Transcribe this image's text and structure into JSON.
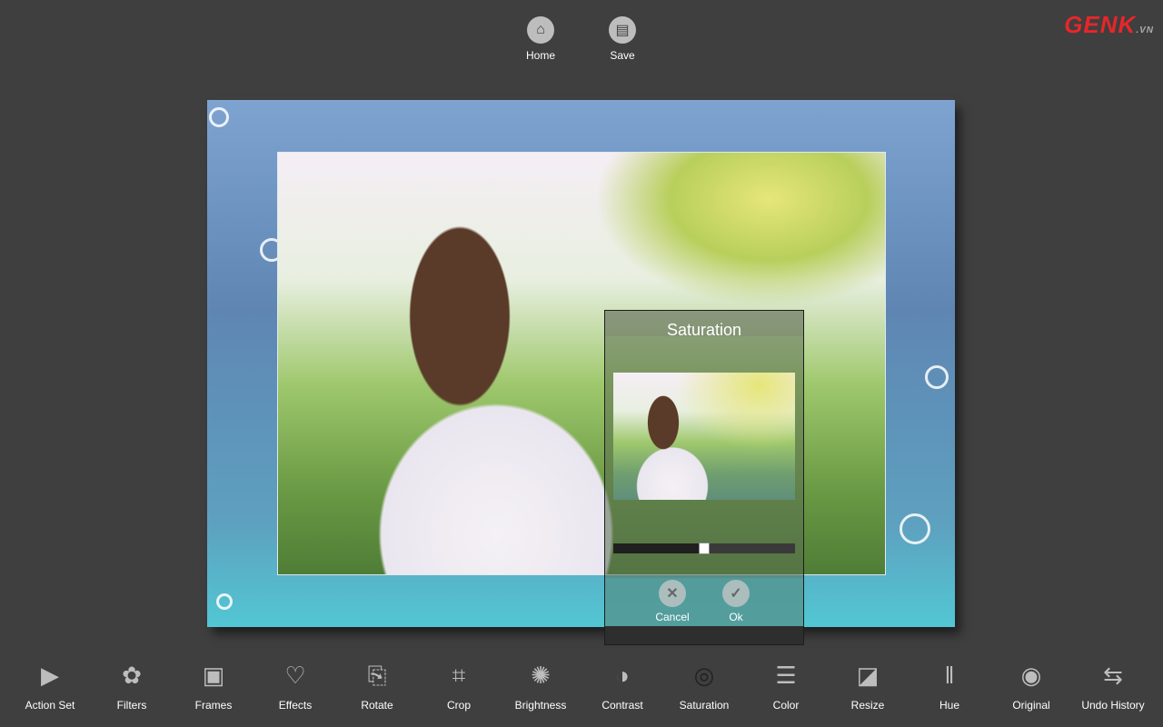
{
  "top": {
    "home": "Home",
    "save": "Save"
  },
  "logo": {
    "text": "GENK",
    "suffix": ".VN"
  },
  "dialog": {
    "title": "Saturation",
    "slider_value": 0.5,
    "cancel": "Cancel",
    "ok": "Ok"
  },
  "toolbar": [
    {
      "label": "Action Set",
      "icon": "play-icon",
      "glyph": "▶"
    },
    {
      "label": "Filters",
      "icon": "flower-icon",
      "glyph": "✿"
    },
    {
      "label": "Frames",
      "icon": "frame-star-icon",
      "glyph": "▣"
    },
    {
      "label": "Effects",
      "icon": "heart-icon",
      "glyph": "♡"
    },
    {
      "label": "Rotate",
      "icon": "rotate-icon",
      "glyph": "⎘"
    },
    {
      "label": "Crop",
      "icon": "crop-icon",
      "glyph": "⌗"
    },
    {
      "label": "Brightness",
      "icon": "sun-icon",
      "glyph": "✺"
    },
    {
      "label": "Contrast",
      "icon": "contrast-icon",
      "glyph": "◑"
    },
    {
      "label": "Saturation",
      "icon": "spiral-icon",
      "glyph": "◎"
    },
    {
      "label": "Color",
      "icon": "sliders-icon",
      "glyph": "☰"
    },
    {
      "label": "Resize",
      "icon": "resize-icon",
      "glyph": "◪"
    },
    {
      "label": "Hue",
      "icon": "hue-icon",
      "glyph": "‖"
    },
    {
      "label": "Original",
      "icon": "eye-icon",
      "glyph": "◉"
    },
    {
      "label": "Undo History",
      "icon": "undo-history-icon",
      "glyph": "⇆"
    }
  ],
  "colors": {
    "background": "#3f3f3f",
    "icon": "#bdbdbd",
    "active_icon": "#222222",
    "logo": "#e8262a"
  }
}
